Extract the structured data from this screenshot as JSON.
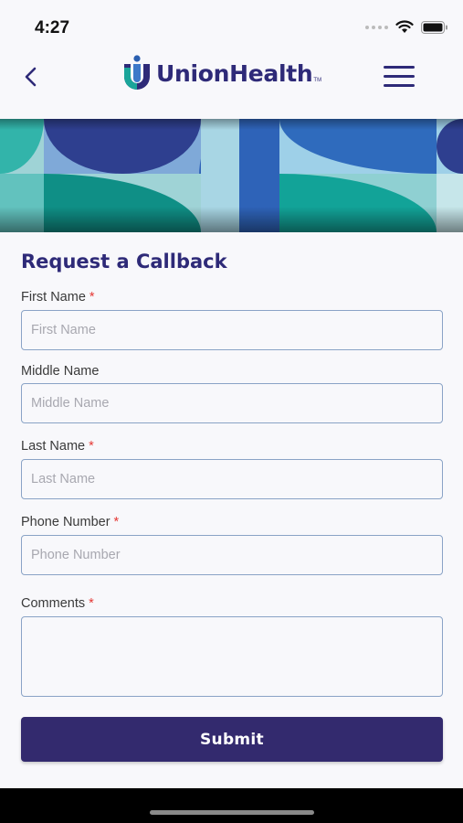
{
  "status": {
    "time": "4:27"
  },
  "header": {
    "brand": "UnionHealth",
    "trademark": "TM"
  },
  "icons": {
    "back": "chevron-left-icon",
    "menu": "hamburger-menu-icon",
    "wifi": "wifi-icon",
    "battery": "battery-icon"
  },
  "colors": {
    "brand": "#2e2a78",
    "button": "#332a6e",
    "required": "#e53935",
    "input_border": "#8aa3c6"
  },
  "form": {
    "title": "Request a Callback",
    "fields": {
      "first_name": {
        "label": "First Name",
        "placeholder": "First Name",
        "required": "*"
      },
      "middle_name": {
        "label": "Middle Name",
        "placeholder": "Middle Name"
      },
      "last_name": {
        "label": "Last Name",
        "placeholder": "Last Name",
        "required": "*"
      },
      "phone": {
        "label": "Phone Number",
        "placeholder": "Phone Number",
        "required": "*"
      },
      "comments": {
        "label": "Comments",
        "placeholder": "",
        "required": "*"
      }
    },
    "submit_label": "Submit"
  }
}
